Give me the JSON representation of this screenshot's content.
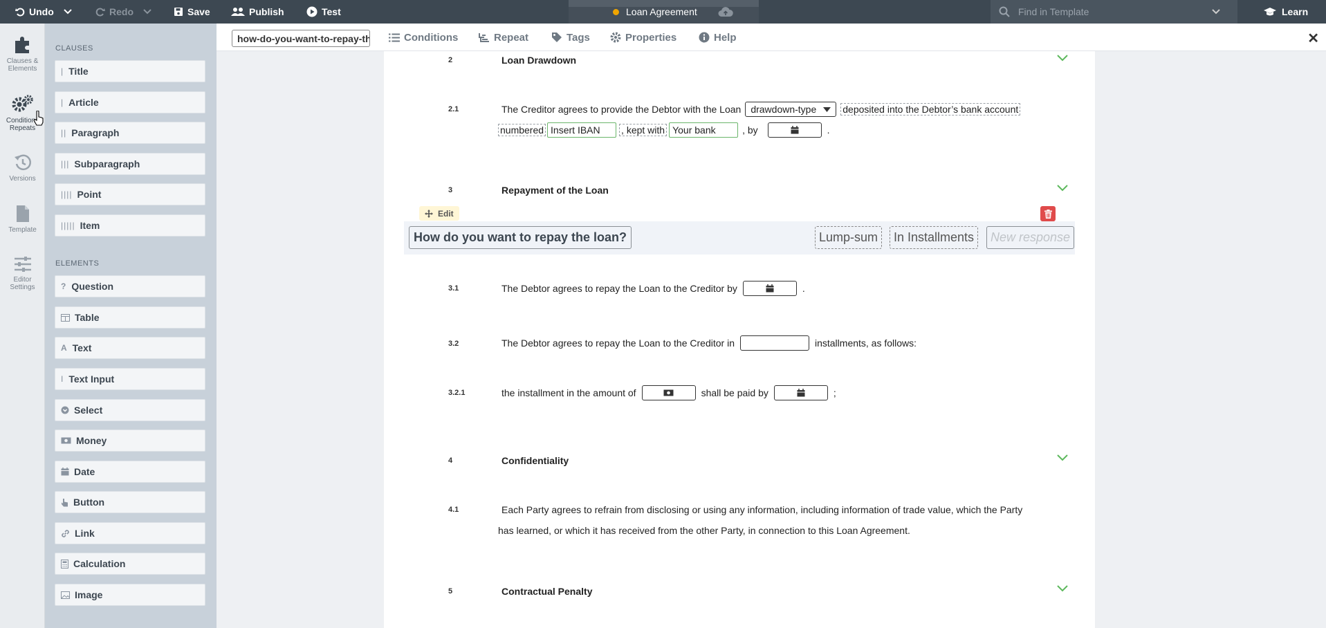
{
  "topbar": {
    "undo": "Undo",
    "redo": "Redo",
    "save": "Save",
    "publish": "Publish",
    "test": "Test",
    "document_title": "Loan Agreement",
    "find_placeholder": "Find in Template",
    "learn": "Learn",
    "status_color": "#f0a500"
  },
  "rail": {
    "clauses": "Clauses & Elements",
    "conditions": "Conditions Repeats",
    "versions": "Versions",
    "template": "Template",
    "editor_settings": "Editor Settings"
  },
  "palette": {
    "clauses_heading": "CLAUSES",
    "clauses": [
      {
        "label": "Title",
        "prefix": "|"
      },
      {
        "label": "Article",
        "prefix": "|"
      },
      {
        "label": "Paragraph",
        "prefix": "||"
      },
      {
        "label": "Subparagraph",
        "prefix": "|||"
      },
      {
        "label": "Point",
        "prefix": "||||"
      },
      {
        "label": "Item",
        "prefix": "|||||"
      }
    ],
    "elements_heading": "ELEMENTS",
    "elements": [
      {
        "label": "Question",
        "icon": "question-icon"
      },
      {
        "label": "Table",
        "icon": "table-icon"
      },
      {
        "label": "Text",
        "icon": "text-icon"
      },
      {
        "label": "Text Input",
        "icon": "text-cursor-icon"
      },
      {
        "label": "Select",
        "icon": "select-icon"
      },
      {
        "label": "Money",
        "icon": "money-icon"
      },
      {
        "label": "Date",
        "icon": "calendar-icon"
      },
      {
        "label": "Button",
        "icon": "pointer-icon"
      },
      {
        "label": "Link",
        "icon": "link-icon"
      },
      {
        "label": "Calculation",
        "icon": "calculator-icon"
      },
      {
        "label": "Image",
        "icon": "image-icon"
      }
    ]
  },
  "subbar": {
    "slug": "how-do-you-want-to-repay-the-loan",
    "conditions": "Conditions",
    "repeat": "Repeat",
    "tags": "Tags",
    "properties": "Properties",
    "help": "Help"
  },
  "document": {
    "s2_num": "2",
    "s2_title": "Loan Drawdown",
    "s21_num": "2.1",
    "s21_a": "The Creditor agrees to provide the Debtor with the Loan",
    "s21_select": "drawdown-type",
    "s21_b": "deposited into the Debtor’s bank account",
    "s21_c": "numbered",
    "s21_iban": "Insert IBAN",
    "s21_d": ", kept with",
    "s21_bank": "Your bank",
    "s21_e": ", by",
    "s21_end": ".",
    "s3_num": "3",
    "s3_title": "Repayment of the Loan",
    "edit": "Edit",
    "question": "How do you want to repay the loan?",
    "responses": [
      "Lump-sum",
      "In Installments"
    ],
    "new_response": "New response",
    "s31_num": "3.1",
    "s31_text": "The Debtor agrees to repay the Loan to the Creditor by",
    "s31_end": ".",
    "s32_num": "3.2",
    "s32_a": "The Debtor agrees to repay the Loan to the Creditor in",
    "s32_b": "installments, as follows:",
    "s321_num": "3.2.1",
    "s321_a": "the installment in the amount of",
    "s321_b": "shall be paid by",
    "s321_end": ";",
    "s4_num": "4",
    "s4_title": "Confidentiality",
    "s41_num": "4.1",
    "s41_line1": "Each Party agrees to refrain from disclosing or using any information, including information of trade value, which the Party",
    "s41_line2": "has learned, or which it has received from the other Party, in connection to this Loan Agreement.",
    "s5_num": "5",
    "s5_title": "Contractual Penalty"
  }
}
